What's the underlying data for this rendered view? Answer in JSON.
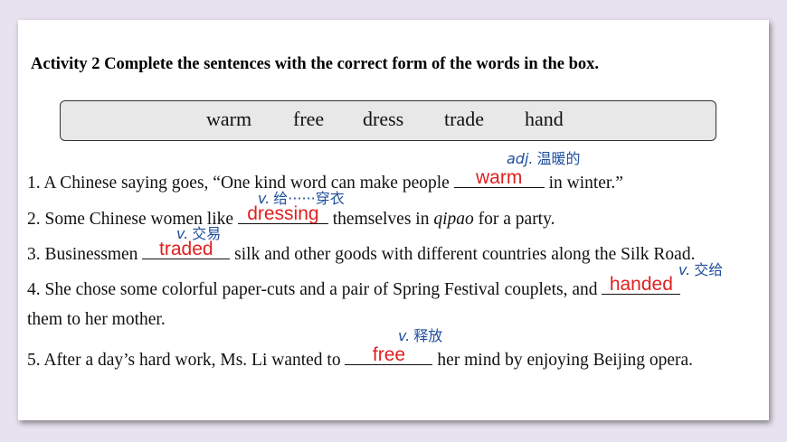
{
  "title": "Activity 2 Complete the sentences with the correct form of the words in the box.",
  "word_box": [
    "warm",
    "free",
    "dress",
    "trade",
    "hand"
  ],
  "sentences": [
    {
      "pre": "1. A Chinese saying goes, “One kind word can make people ",
      "answer": "warm",
      "post": " in winter.”"
    },
    {
      "pre": "2. Some Chinese women like ",
      "answer": "dressing",
      "post": " themselves in ",
      "italic": "qipao",
      "post2": " for a party."
    },
    {
      "pre": "3. Businessmen ",
      "answer": "traded",
      "post": " silk and other goods with different countries along the Silk Road."
    },
    {
      "pre": "4. She chose some colorful paper-cuts and a pair of Spring Festival couplets, and ",
      "answer": "handed",
      "post": ""
    },
    {
      "cont": "them to her mother."
    },
    {
      "pre": "5. After a day’s hard work, Ms. Li wanted to ",
      "answer": "free",
      "post": " her mind by enjoying Beijing opera."
    }
  ],
  "notes": [
    {
      "pos": "adj.",
      "meaning": "温暖的"
    },
    {
      "pos": "v.",
      "meaning": "给······穿衣"
    },
    {
      "pos": "v.",
      "meaning": "交易"
    },
    {
      "pos": "v.",
      "meaning": "交给"
    },
    {
      "pos": "v.",
      "meaning": "释放"
    }
  ]
}
